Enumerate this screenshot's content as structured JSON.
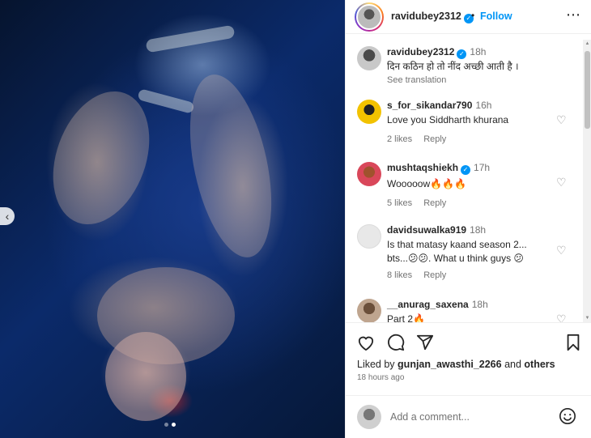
{
  "header": {
    "username": "ravidubey2312",
    "separator": "•",
    "follow_label": "Follow",
    "more_label": "⋯"
  },
  "caption": {
    "username": "ravidubey2312",
    "time": "18h",
    "text": "दिन कठिन हो तो नींद अच्छी आती है ।",
    "see_translation": "See translation"
  },
  "comments": [
    {
      "username": "s_for_sikandar790",
      "time": "16h",
      "text": "Love you Siddharth khurana",
      "likes": "2 likes",
      "reply": "Reply",
      "verified": false
    },
    {
      "username": "mushtaqshiekh",
      "time": "17h",
      "text": "Wooooow🔥🔥🔥",
      "likes": "5 likes",
      "reply": "Reply",
      "verified": true
    },
    {
      "username": "davidsuwalka919",
      "time": "18h",
      "text": "Is that matasy kaand season 2... bts...😕😕. What u think guys 😕",
      "likes": "8 likes",
      "reply": "Reply",
      "verified": false
    },
    {
      "username": "__anurag_saxena",
      "time": "18h",
      "text": "Part 2🔥",
      "likes": "",
      "reply": "",
      "verified": false
    }
  ],
  "actions": {
    "liked_prefix": "Liked by",
    "liked_user": "gunjan_awasthi_2266",
    "liked_and": "and",
    "liked_others": "others",
    "time_ago": "18 hours ago"
  },
  "add_comment": {
    "placeholder": "Add a comment..."
  },
  "carousel": {
    "prev_label": "‹",
    "dot_count": 2,
    "active_dot": 1
  },
  "colors": {
    "accent": "#0095f6",
    "text": "#262626",
    "muted": "#737373",
    "verified": "#0095f6"
  },
  "icons": [
    "heart-icon",
    "comment-icon",
    "share-icon",
    "bookmark-icon",
    "emoji-icon",
    "more-icon",
    "verified-icon",
    "chevron-left-icon"
  ]
}
